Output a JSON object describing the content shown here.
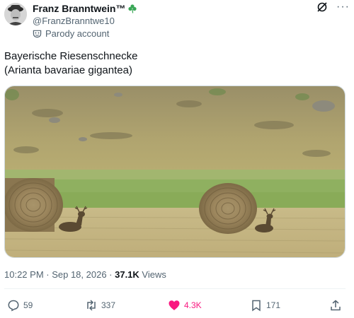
{
  "author": {
    "display_name": "Franz Branntwein™",
    "handle": "@FranzBranntwe10",
    "parody_label": "Parody account",
    "badge_icon": "shamrock-icon"
  },
  "tweet": {
    "line1": "Bayerische Riesenschnecke",
    "line2": "(Arianta bavariae gigantea)"
  },
  "meta": {
    "time_date": "10:22 PM · Sep 18, 2026 · ",
    "views_count": "37.1K",
    "views_label": " Views"
  },
  "actions": {
    "replies": "59",
    "retweets": "337",
    "likes": "4.3K",
    "bookmarks": "171"
  },
  "colors": {
    "like_active": "#f91880",
    "secondary_text": "#536471",
    "clover_green": "#3aa757"
  },
  "icons": [
    "grok-icon",
    "more-icon",
    "parody-mask-icon",
    "reply-icon",
    "retweet-icon",
    "heart-icon",
    "bookmark-icon",
    "share-icon"
  ]
}
